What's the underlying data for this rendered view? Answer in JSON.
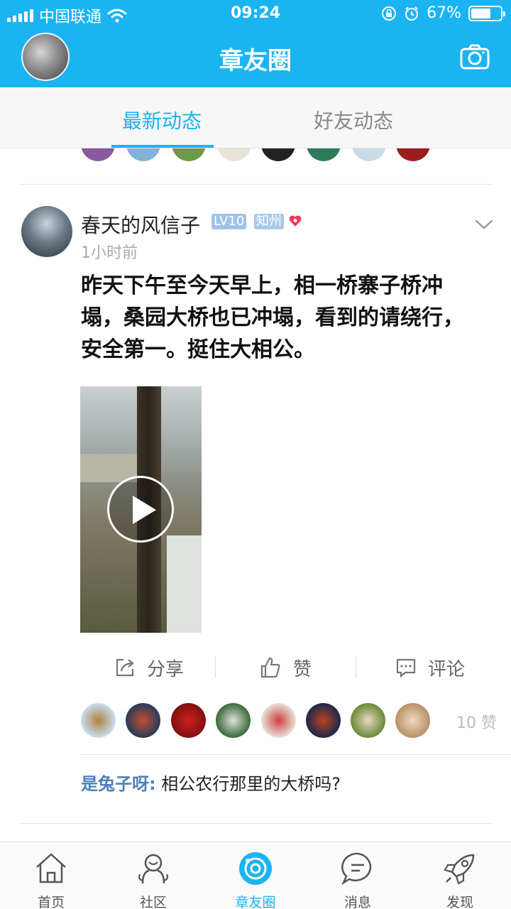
{
  "status_bar": {
    "carrier": "中国联通",
    "time": "09:24",
    "battery": "67%",
    "battery_level": 0.67,
    "icons": [
      "signal-icon",
      "wifi-icon",
      "rotation-lock-icon",
      "alarm-icon",
      "battery-icon"
    ]
  },
  "header": {
    "title": "章友圈",
    "left_icon": "user-avatar",
    "right_icon": "camera-icon",
    "color": "#1bb4f2"
  },
  "tabs": [
    {
      "label": "最新动态",
      "active": true
    },
    {
      "label": "好友动态",
      "active": false
    }
  ],
  "post": {
    "author": "春天的风信子",
    "level": "LV10",
    "region": "知州",
    "time_ago": "1小时前",
    "text": "昨天下午至今天早上，相一桥寨子桥冲塌，桑园大桥也已冲塌，看到的请绕行，安全第一。挺住大相公。",
    "media": "video",
    "actions": {
      "share": "分享",
      "like": "赞",
      "comment": "评论"
    },
    "like_count": "10 赞",
    "comments": [
      {
        "author": "是兔子呀:",
        "text": "相公农行那里的大桥吗?"
      }
    ]
  },
  "bottom_nav": [
    {
      "label": "首页",
      "icon": "home-icon",
      "active": false
    },
    {
      "label": "社区",
      "icon": "community-icon",
      "active": false
    },
    {
      "label": "章友圈",
      "icon": "moments-icon",
      "active": true
    },
    {
      "label": "消息",
      "icon": "message-icon",
      "active": false
    },
    {
      "label": "发现",
      "icon": "rocket-icon",
      "active": false
    }
  ],
  "colors": {
    "accent": "#1bb4f2",
    "author_link": "#4f7fb8"
  }
}
